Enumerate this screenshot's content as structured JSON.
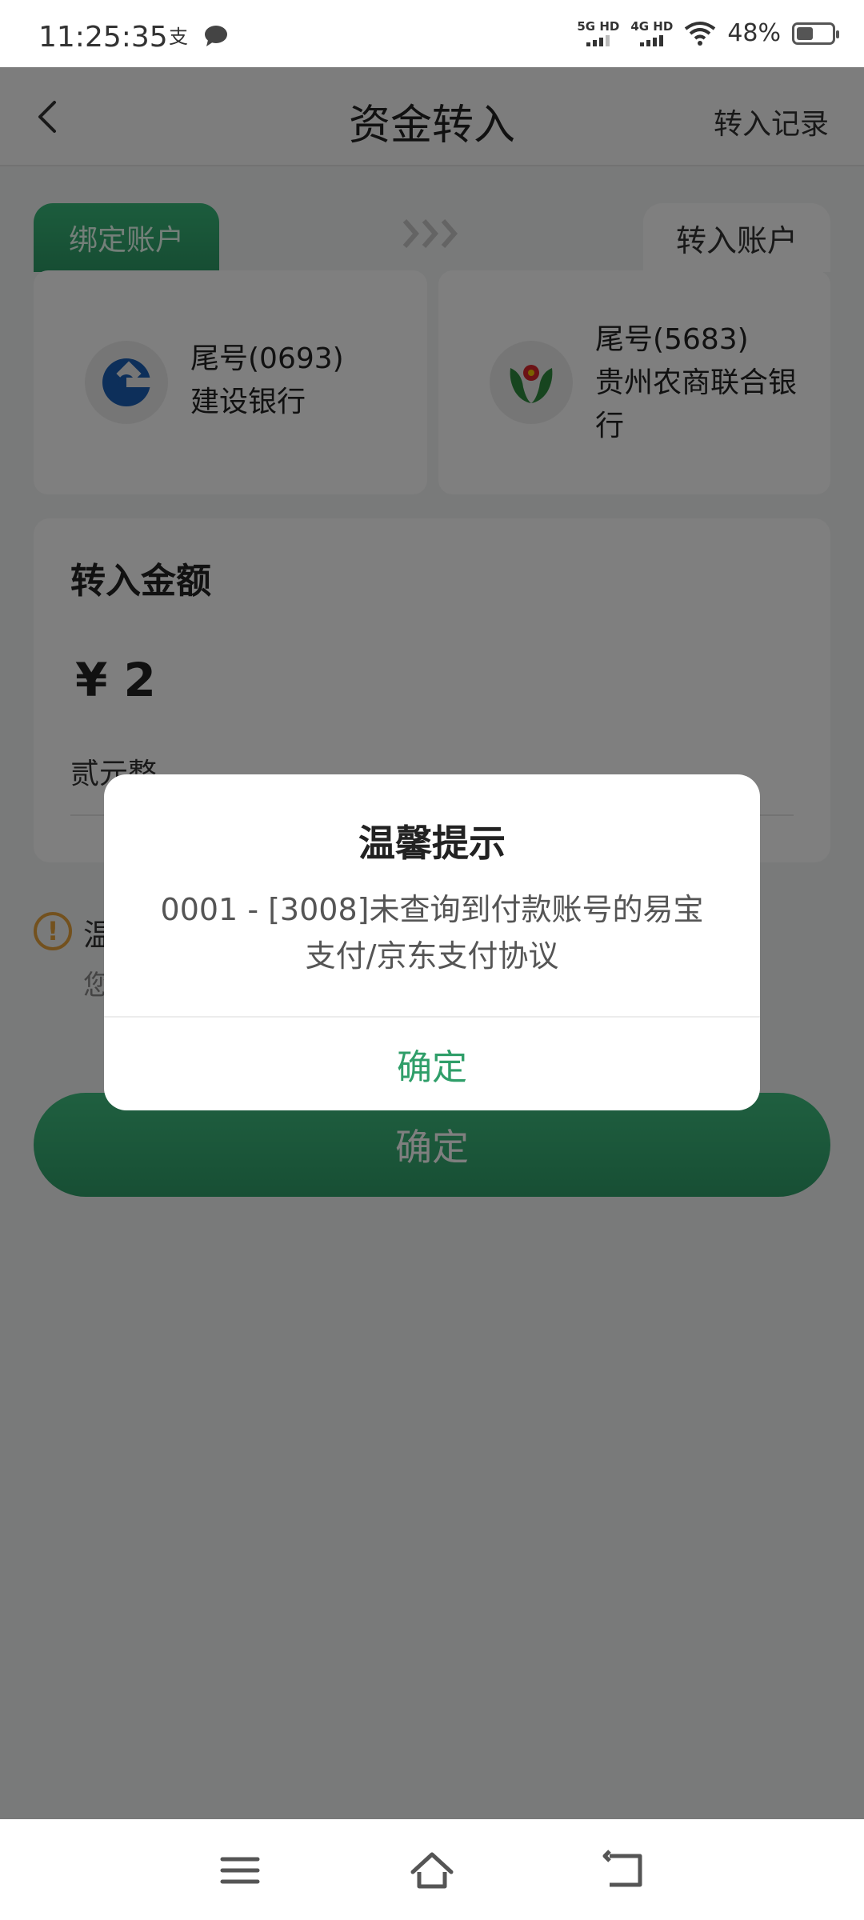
{
  "status_bar": {
    "time": "11:25:35",
    "net1_label": "5G HD",
    "net2_label": "4G HD",
    "battery_text": "48%",
    "battery_level": 0.48
  },
  "header": {
    "title": "资金转入",
    "record_label": "转入记录"
  },
  "accounts": {
    "bound_tab": "绑定账户",
    "in_tab": "转入账户",
    "bound": {
      "tail": "尾号(0693)",
      "bank": "建设银行",
      "icon": "ccb-logo-icon"
    },
    "target": {
      "tail": "尾号(5683)",
      "bank": "贵州农商联合银行",
      "icon": "guizhou-rcb-logo-icon"
    }
  },
  "amount": {
    "label": "转入金额",
    "value": "¥ 2",
    "words": "贰元整"
  },
  "notice": {
    "title": "温",
    "body": "您"
  },
  "confirm_label": "确定",
  "dialog": {
    "title": "温馨提示",
    "message": "0001 - [3008]未查询到付款账号的易宝支付/京东支付协议",
    "button": "确定"
  },
  "colors": {
    "accent": "#2f9e69",
    "warning": "#e6a23c"
  }
}
